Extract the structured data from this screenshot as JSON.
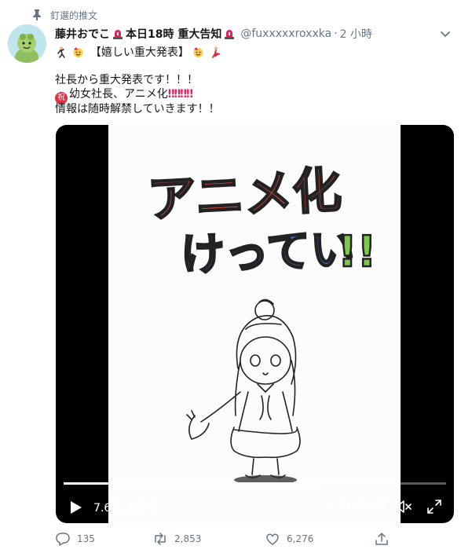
{
  "pinned": {
    "label": "釘選的推文",
    "icon": "pin-icon"
  },
  "tweet": {
    "author_name": "藤井おでこ",
    "name_suffix": "本日18時 重大告知",
    "handle": "@fuxxxxxroxxka",
    "separator": "·",
    "time": "2 小時",
    "line1": "【嬉しい重大発表】",
    "line2": "社長から重大発表です！！！",
    "line3_a": "幼女社長、アニメ化",
    "line3_marks": "‼‼‼‼",
    "line3_circle": "祝",
    "line4": "情報は随時解禁していきます！！"
  },
  "video": {
    "views": "7.6萬 次觀看",
    "time": "0:04 / 0:06",
    "progress_fraction": 0.667,
    "title_line1": "アニメ化",
    "title_line2": "けってい",
    "title_bang": "!!"
  },
  "actions": {
    "reply_count": "135",
    "retweet_count": "2,853",
    "like_count": "6,276"
  },
  "colors": {
    "accent": "#1da1f2",
    "text_secondary": "#657786",
    "siren": "#e0245e"
  }
}
